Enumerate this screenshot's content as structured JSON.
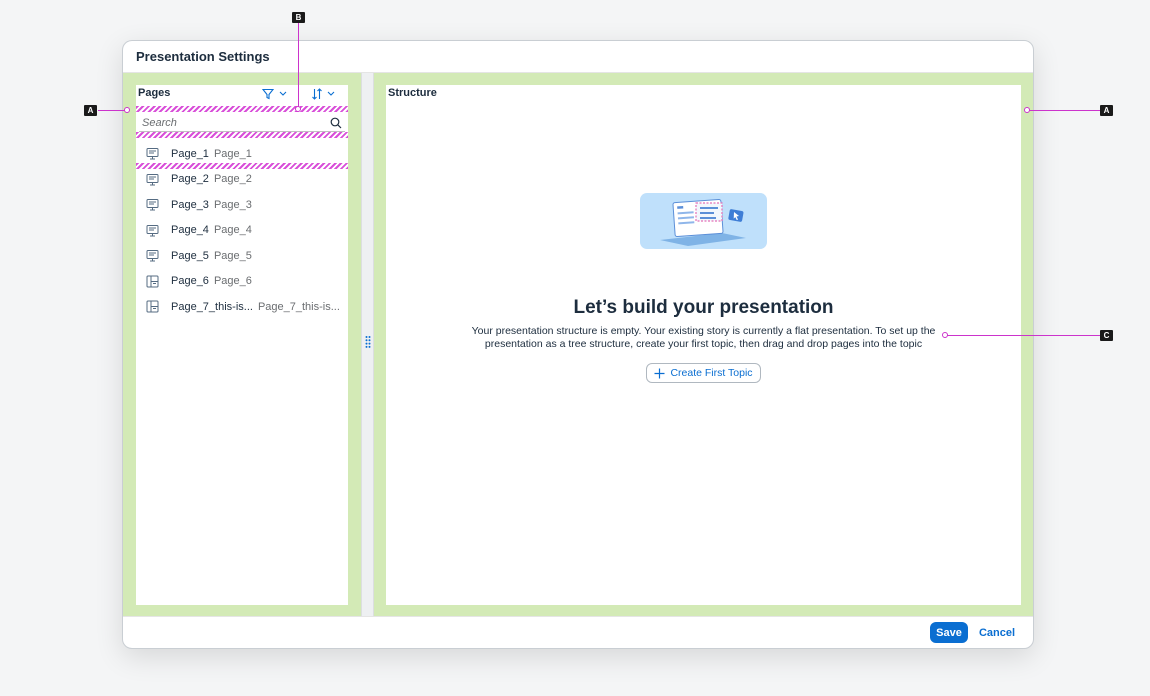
{
  "dialog": {
    "title": "Presentation Settings"
  },
  "pages_panel": {
    "title": "Pages",
    "search": {
      "placeholder": "Search",
      "value": ""
    },
    "items": [
      {
        "name": "Page_1",
        "description": "Page_1",
        "icon": "presentation-icon"
      },
      {
        "name": "Page_2",
        "description": "Page_2",
        "icon": "presentation-icon"
      },
      {
        "name": "Page_3",
        "description": "Page_3",
        "icon": "presentation-icon"
      },
      {
        "name": "Page_4",
        "description": "Page_4",
        "icon": "presentation-icon"
      },
      {
        "name": "Page_5",
        "description": "Page_5",
        "icon": "presentation-icon"
      },
      {
        "name": "Page_6",
        "description": "Page_6",
        "icon": "layout-icon"
      },
      {
        "name": "Page_7_this-is...",
        "description": "Page_7_this-is...",
        "icon": "layout-icon"
      }
    ]
  },
  "structure_panel": {
    "title": "Structure",
    "empty_title": "Let’s build your presentation",
    "empty_text": "Your presentation structure is empty. Your existing story is currently a flat presentation. To set up the presentation as a tree structure, create your first topic, then drag and drop pages into the topic",
    "create_button": "Create First Topic"
  },
  "footer": {
    "save": "Save",
    "cancel": "Cancel"
  },
  "annotations": {
    "a_left": "A",
    "a_right": "A",
    "b": "B",
    "c": "C"
  },
  "colors": {
    "accent": "#0a6ed1",
    "highlight_area": "#d3eab6",
    "annotation_line": "#cc33cc"
  }
}
